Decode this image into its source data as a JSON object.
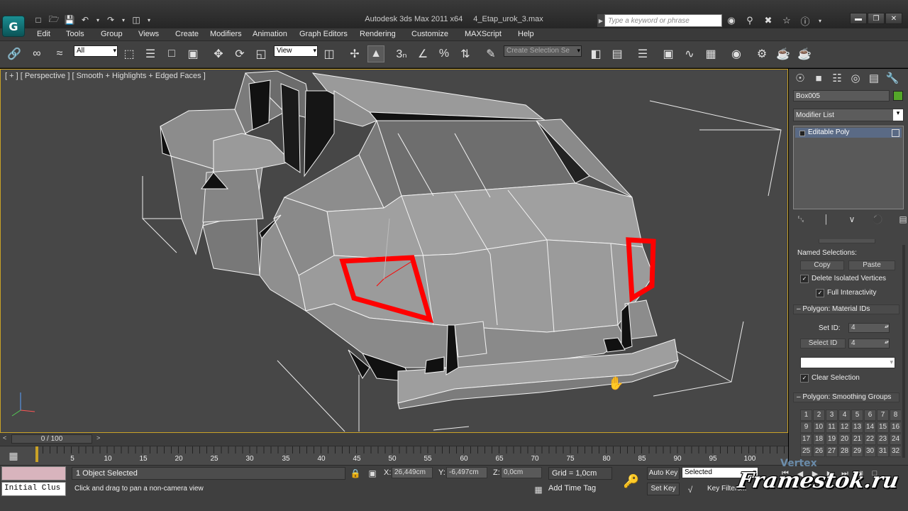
{
  "titlebar": {
    "app_name": "Autodesk 3ds Max  2011 x64",
    "file_name": "4_Etap_urok_3.max",
    "search_placeholder": "Type a keyword or phrase",
    "logo_glyph": "G"
  },
  "menus": [
    "Edit",
    "Tools",
    "Group",
    "Views",
    "Create",
    "Modifiers",
    "Animation",
    "Graph Editors",
    "Rendering",
    "Customize",
    "MAXScript",
    "Help"
  ],
  "toolbar": {
    "filter_value": "All",
    "ref_coord_value": "View",
    "selection_set_placeholder": "Create Selection Se"
  },
  "viewport": {
    "label": "[ + ] [ Perspective ] [ Smooth + Highlights + Edged Faces ]",
    "selection_color": "#ff0000",
    "background_color": "#474747"
  },
  "command_panel": {
    "object_name": "Box005",
    "object_color": "#54a629",
    "modifier_list_label": "Modifier List",
    "stack_item": "Editable Poly",
    "named_selections_label": "Named Selections:",
    "copy_label": "Copy",
    "paste_label": "Paste",
    "delete_isolated_label": "Delete Isolated Vertices",
    "full_interactivity_label": "Full Interactivity",
    "material_ids_header": "Polygon: Material IDs",
    "set_id_label": "Set ID:",
    "set_id_value": "4",
    "select_id_label": "Select ID",
    "select_id_value": "4",
    "clear_selection_label": "Clear Selection",
    "smoothing_header": "Polygon: Smoothing Groups",
    "smoothing_groups": [
      "1",
      "2",
      "3",
      "4",
      "5",
      "6",
      "7",
      "8",
      "9",
      "10",
      "11",
      "12",
      "13",
      "14",
      "15",
      "16",
      "17",
      "18",
      "19",
      "20",
      "21",
      "22",
      "23",
      "24",
      "25",
      "26",
      "27",
      "28",
      "29",
      "30",
      "31",
      "32"
    ]
  },
  "time_slider": {
    "position_label": "0 / 100",
    "ticks": [
      "5",
      "10",
      "15",
      "20",
      "25",
      "30",
      "35",
      "40",
      "45",
      "50",
      "55",
      "60",
      "65",
      "70",
      "75",
      "80",
      "85",
      "90",
      "95",
      "100"
    ]
  },
  "status": {
    "selection_text": "1 Object Selected",
    "prompt_text": "Click and drag to pan a non-camera view",
    "listener_text": "Initial Clus",
    "x_label": "X:",
    "x_value": "26,449cm",
    "y_label": "Y:",
    "y_value": "-6,497cm",
    "z_label": "Z:",
    "z_value": "0,0cm",
    "grid_text": "Grid = 1,0cm",
    "add_time_tag": "Add Time Tag",
    "auto_key": "Auto Key",
    "set_key": "Set Key",
    "key_mode_value": "Selected",
    "key_filters": "Key Filters..."
  },
  "watermark": {
    "text": "Framestok.ru",
    "small_text": "Vertex"
  }
}
